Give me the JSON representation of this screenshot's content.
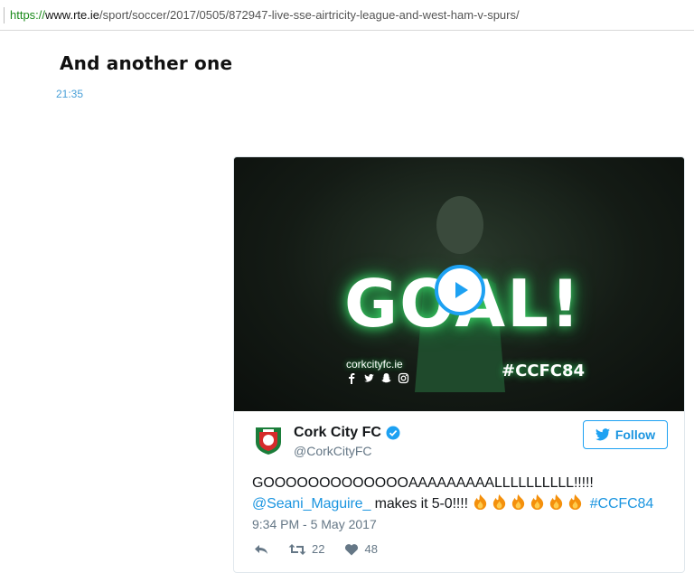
{
  "browser": {
    "url_scheme": "https://",
    "url_host": "www.rte.ie",
    "url_path": "/sport/soccer/2017/0505/872947-live-sse-airtricity-league-and-west-ham-v-spurs/"
  },
  "post": {
    "headline": "And another one",
    "time": "21:35"
  },
  "tweet": {
    "media": {
      "goal_text": "GOAL!",
      "site_text": "corkcityfc.ie",
      "hashtag": "#CCFC84",
      "play_icon": "play-icon"
    },
    "author_name": "Cork City FC",
    "handle": "@CorkCityFC",
    "follow_label": "Follow",
    "text_line1": "GOOOOOOOOOOOOOAAAAAAAAALLLLLLLLLL!!!!!",
    "mention": "@Seani_Maguire_",
    "text_mid": "makes it 5-0!!!!",
    "fire_count": 6,
    "hashtag": "#CCFC84",
    "date": "9:34 PM - 5 May 2017",
    "retweets": "22",
    "likes": "48"
  },
  "colors": {
    "twitter_blue": "#1da1f2",
    "link_blue": "#1b95e0",
    "time_blue": "#4aa0d8",
    "url_green": "#1a8a1a",
    "glow_green": "#3ddc6a"
  }
}
